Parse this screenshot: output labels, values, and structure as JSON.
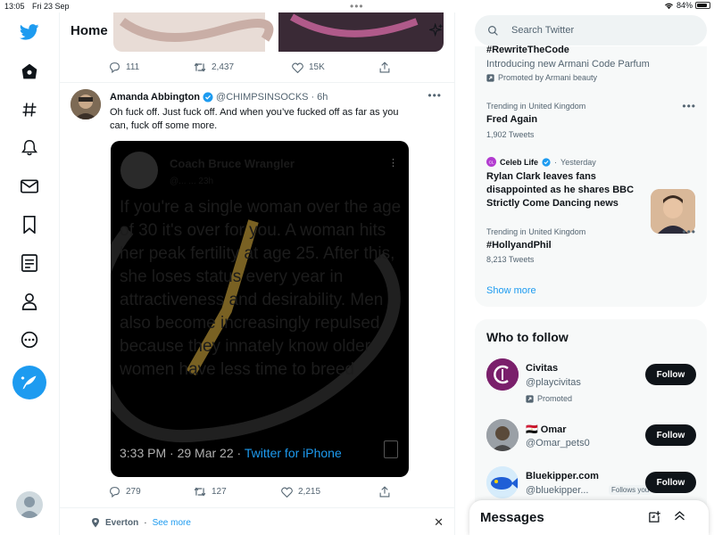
{
  "status_bar": {
    "time": "13:05",
    "date": "Fri 23 Sep",
    "battery": "84%",
    "battery_level": 0.84
  },
  "nav": {
    "icons": [
      "twitter-logo-icon",
      "home-icon",
      "explore-hash-icon",
      "notifications-bell-icon",
      "messages-mail-icon",
      "bookmarks-icon",
      "lists-icon",
      "profile-icon",
      "more-circle-icon"
    ],
    "compose": "compose-tweet-icon"
  },
  "header": {
    "title": "Home"
  },
  "prev_tweet": {
    "replies": "111",
    "retweets": "2,437",
    "likes": "15K"
  },
  "tweet": {
    "author": "Amanda Abbington",
    "handle": "@CHIMPSINSOCKS",
    "time": "6h",
    "text": "Oh fuck off. Just fuck off. And when you’ve fucked off as far as you can, fuck off some more.",
    "embedded": {
      "author": "Coach Bruce Wrangler",
      "handle": "@... ... 23h",
      "text": "If you're a single woman over the age of 30 it's over for you. A woman hits her peak fertility at age 25. After this, she loses status every year in attractiveness and desirability. Men also become increasingly repulsed because they innately know older women have less time to breed",
      "footer_time": "3:33 PM · 29 Mar 22 · ",
      "footer_via": "Twitter for iPhone"
    },
    "replies": "279",
    "retweets": "127",
    "likes": "2,215"
  },
  "trends_location": {
    "place": "Everton",
    "see_more": "See more"
  },
  "search": {
    "placeholder": "Search Twitter"
  },
  "trends": {
    "promoted_tag": "#RewriteTheCode",
    "promoted_desc": "Introducing new Armani Code Parfum",
    "promoted_by": "Promoted by Armani beauty",
    "items": [
      {
        "context": "Trending in United Kingdom",
        "title": "Fred Again",
        "count": "1,902 Tweets"
      },
      {
        "context": "Trending in United Kingdom",
        "title": "#HollyandPhil",
        "count": "8,213 Tweets"
      }
    ],
    "news": {
      "source": "Celeb Life",
      "time": "Yesterday",
      "headline": "Rylan Clark leaves fans disappointed as he shares BBC Strictly Come Dancing news"
    },
    "show_more": "Show more"
  },
  "who_to_follow": {
    "title": "Who to follow",
    "accounts": [
      {
        "name": "Civitas",
        "handle": "@playcivitas",
        "note": "Promoted",
        "button": "Follow"
      },
      {
        "name": "Omar",
        "flag": "🇪🇬",
        "handle": "@Omar_pets0",
        "button": "Follow"
      },
      {
        "name": "Bluekipper.com",
        "handle": "@bluekipper...",
        "note": "Follows you",
        "button": "Follow"
      }
    ]
  },
  "messages": {
    "label": "Messages"
  }
}
